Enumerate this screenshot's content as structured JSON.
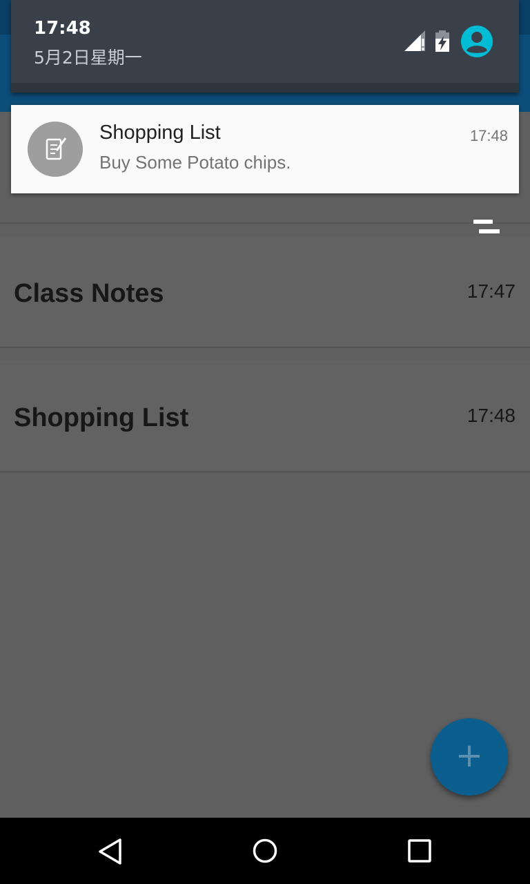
{
  "status_shade": {
    "time": "17:48",
    "date": "5月2日星期一",
    "icons": [
      "signal-no-data-icon",
      "battery-charging-icon",
      "account-avatar-icon"
    ]
  },
  "notification": {
    "app_icon": "note-edit-icon",
    "title": "Shopping List",
    "time": "17:48",
    "text": "Buy Some Potato chips."
  },
  "toolbar": {
    "sort_icon": "sort-icon"
  },
  "notes": [
    {
      "title": "Class Notes",
      "time": "17:47"
    },
    {
      "title": "Shopping List",
      "time": "17:48"
    }
  ],
  "fab": {
    "label": "+",
    "icon": "add-icon",
    "color": "#0b5e8e"
  },
  "navbar": {
    "icons": [
      "back-icon",
      "home-icon",
      "recents-icon"
    ]
  },
  "colors": {
    "scrim_background": "#5f5f5f",
    "app_bar": "#0d4d79",
    "shade": "#394049",
    "avatar_accent": "#00bcd4"
  }
}
